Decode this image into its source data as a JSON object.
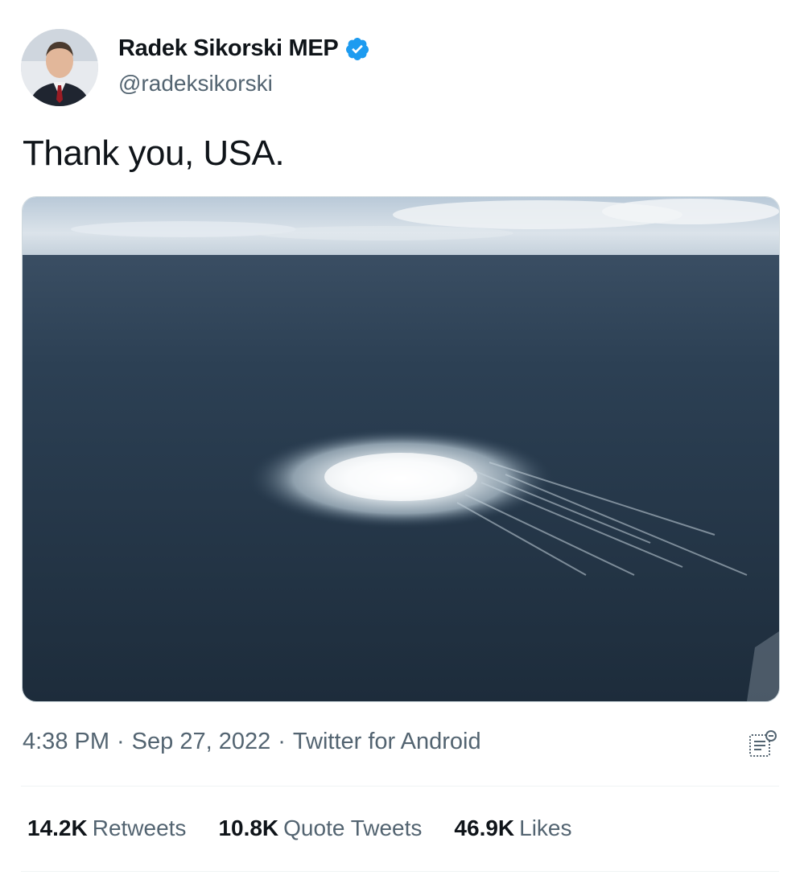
{
  "user": {
    "display_name": "Radek Sikorski MEP",
    "handle": "@radeksikorski",
    "verified_icon": "verified-badge-icon",
    "verified_color": "#1d9bf0"
  },
  "tweet": {
    "text": "Thank you, USA.",
    "time": "4:38 PM",
    "date": "Sep 27, 2022",
    "source": "Twitter for Android",
    "separator": "·"
  },
  "stats": [
    {
      "count": "14.2K",
      "label": "Retweets"
    },
    {
      "count": "10.8K",
      "label": "Quote Tweets"
    },
    {
      "count": "46.9K",
      "label": "Likes"
    }
  ],
  "icons": {
    "analytics": "analytics-icon"
  }
}
